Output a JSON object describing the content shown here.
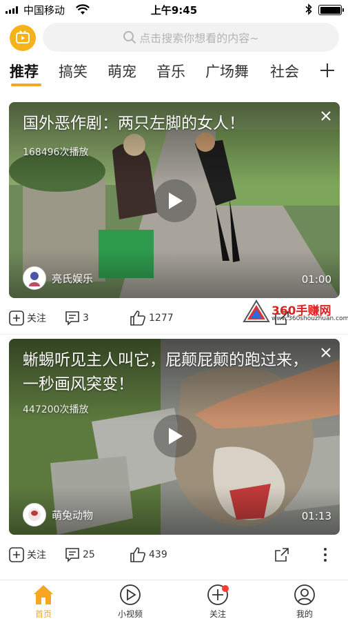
{
  "status_bar": {
    "carrier": "中国移动",
    "time": "上午9:45"
  },
  "header": {
    "search_placeholder": "点击搜索你想看的内容~"
  },
  "tabs": [
    {
      "label": "推荐",
      "active": true
    },
    {
      "label": "搞笑"
    },
    {
      "label": "萌宠"
    },
    {
      "label": "音乐"
    },
    {
      "label": "广场舞"
    },
    {
      "label": "社会"
    }
  ],
  "feed": [
    {
      "title": "国外恶作剧：两只左脚的女人！",
      "play_count": "168496次播放",
      "author": "亮氏娱乐",
      "duration": "01:00",
      "follow_label": "关注",
      "comments": "3",
      "likes": "1277"
    },
    {
      "title": "蜥蜴听见主人叫它，屁颠屁颠的跑过来，一秒画风突变！",
      "play_count": "447200次播放",
      "author": "萌兔动物",
      "duration": "01:13",
      "follow_label": "关注",
      "comments": "25",
      "likes": "439"
    }
  ],
  "watermark": {
    "brand": "360手赚网",
    "url": "www.360shouzhuan.com"
  },
  "bottom_nav": [
    {
      "label": "首页",
      "icon": "home-icon",
      "active": true
    },
    {
      "label": "小视频",
      "icon": "play-circle-icon"
    },
    {
      "label": "关注",
      "icon": "add-circle-icon",
      "badge": true
    },
    {
      "label": "我的",
      "icon": "user-icon"
    }
  ],
  "colors": {
    "accent": "#f5a623",
    "badge": "#f04134"
  }
}
